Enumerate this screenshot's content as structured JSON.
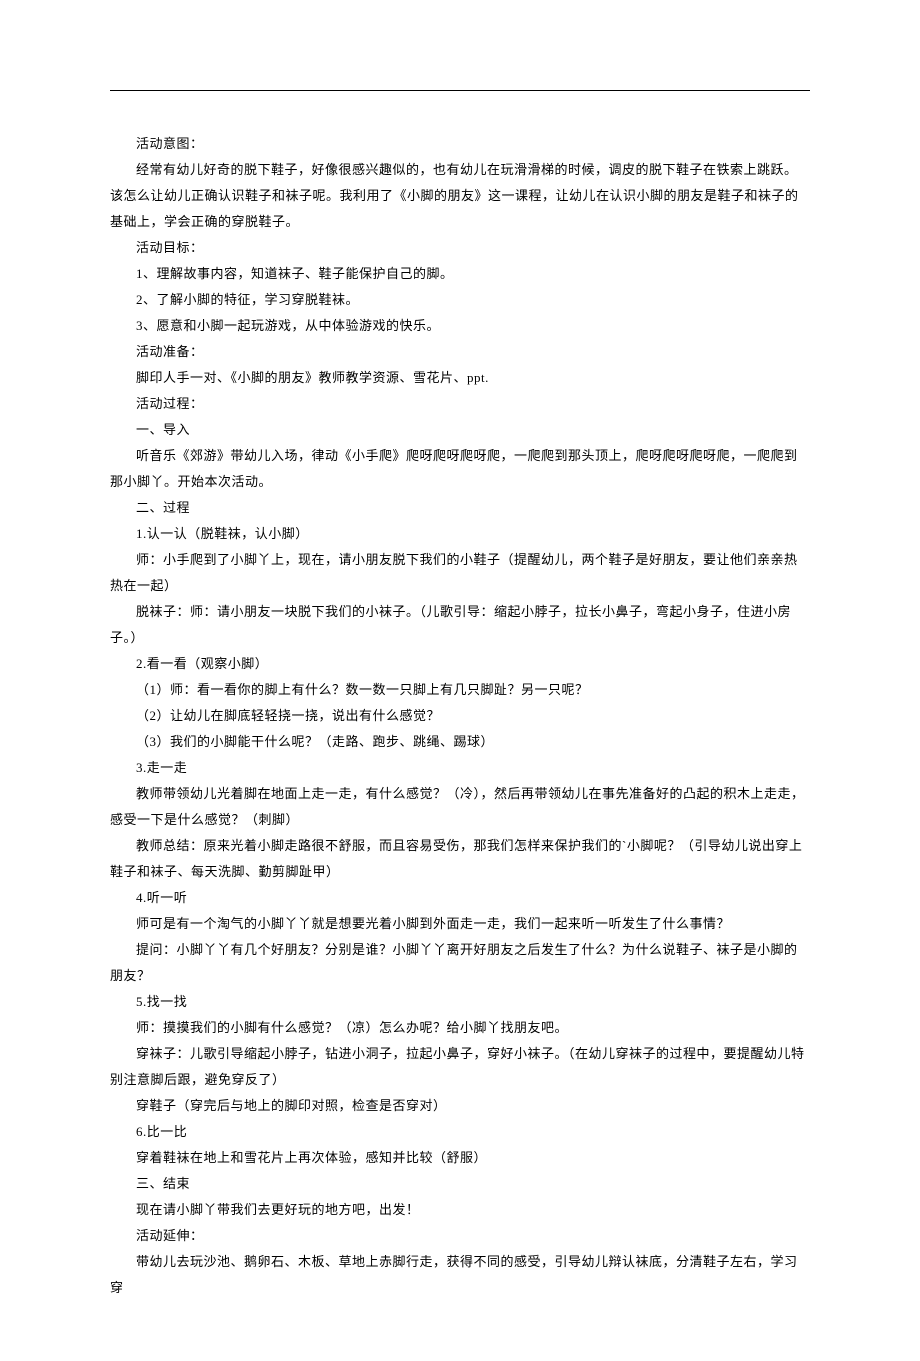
{
  "lines": [
    "活动意图：",
    "经常有幼儿好奇的脱下鞋子，好像很感兴趣似的，也有幼儿在玩滑滑梯的时候，调皮的脱下鞋子在铁索上跳跃。该怎么让幼儿正确认识鞋子和袜子呢。我利用了《小脚的朋友》这一课程，让幼儿在认识小脚的朋友是鞋子和袜子的基础上，学会正确的穿脱鞋子。",
    "活动目标：",
    "1、理解故事内容，知道袜子、鞋子能保护自己的脚。",
    "2、了解小脚的特征，学习穿脱鞋袜。",
    "3、愿意和小脚一起玩游戏，从中体验游戏的快乐。",
    "活动准备：",
    "脚印人手一对、《小脚的朋友》教师教学资源、雪花片、ppt.",
    "活动过程：",
    "一、导入",
    "听音乐《郊游》带幼儿入场，律动《小手爬》爬呀爬呀爬呀爬，一爬爬到那头顶上，爬呀爬呀爬呀爬，一爬爬到那小脚丫。开始本次活动。",
    "二、过程",
    "1.认一认（脱鞋袜，认小脚）",
    "师：小手爬到了小脚丫上，现在，请小朋友脱下我们的小鞋子（提醒幼儿，两个鞋子是好朋友，要让他们亲亲热热在一起）",
    "脱袜子：师：请小朋友一块脱下我们的小袜子。（儿歌引导：缩起小脖子，拉长小鼻子，弯起小身子，住进小房子。）",
    "2.看一看（观察小脚）",
    "（1）师：看一看你的脚上有什么？数一数一只脚上有几只脚趾？另一只呢？",
    "（2）让幼儿在脚底轻轻挠一挠，说出有什么感觉？",
    "（3）我们的小脚能干什么呢？（走路、跑步、跳绳、踢球）",
    "3.走一走",
    "教师带领幼儿光着脚在地面上走一走，有什么感觉？（冷），然后再带领幼儿在事先准备好的凸起的积木上走走，感受一下是什么感觉？（刺脚）",
    "教师总结：原来光着小脚走路很不舒服，而且容易受伤，那我们怎样来保护我们的`小脚呢？（引导幼儿说出穿上鞋子和袜子、每天洗脚、勤剪脚趾甲）",
    "4.听一听",
    "师可是有一个淘气的小脚丫丫就是想要光着小脚到外面走一走，我们一起来听一听发生了什么事情？",
    "提问：小脚丫丫有几个好朋友？分别是谁？小脚丫丫离开好朋友之后发生了什么？为什么说鞋子、袜子是小脚的朋友？",
    "5.找一找",
    "师：摸摸我们的小脚有什么感觉？（凉）怎么办呢？给小脚丫找朋友吧。",
    "穿袜子：儿歌引导缩起小脖子，钻进小洞子，拉起小鼻子，穿好小袜子。（在幼儿穿袜子的过程中，要提醒幼儿特别注意脚后跟，避免穿反了）",
    "穿鞋子（穿完后与地上的脚印对照，检查是否穿对）",
    "6.比一比",
    "穿着鞋袜在地上和雪花片上再次体验，感知并比较（舒服）",
    "三、结束",
    "现在请小脚丫带我们去更好玩的地方吧，出发！",
    "活动延伸：",
    "带幼儿去玩沙池、鹅卵石、木板、草地上赤脚行走，获得不同的感受，引导幼儿辩认袜底，分清鞋子左右，学习穿"
  ],
  "wrapStarts": [
    1,
    10,
    13,
    14,
    20,
    21,
    24,
    27
  ]
}
